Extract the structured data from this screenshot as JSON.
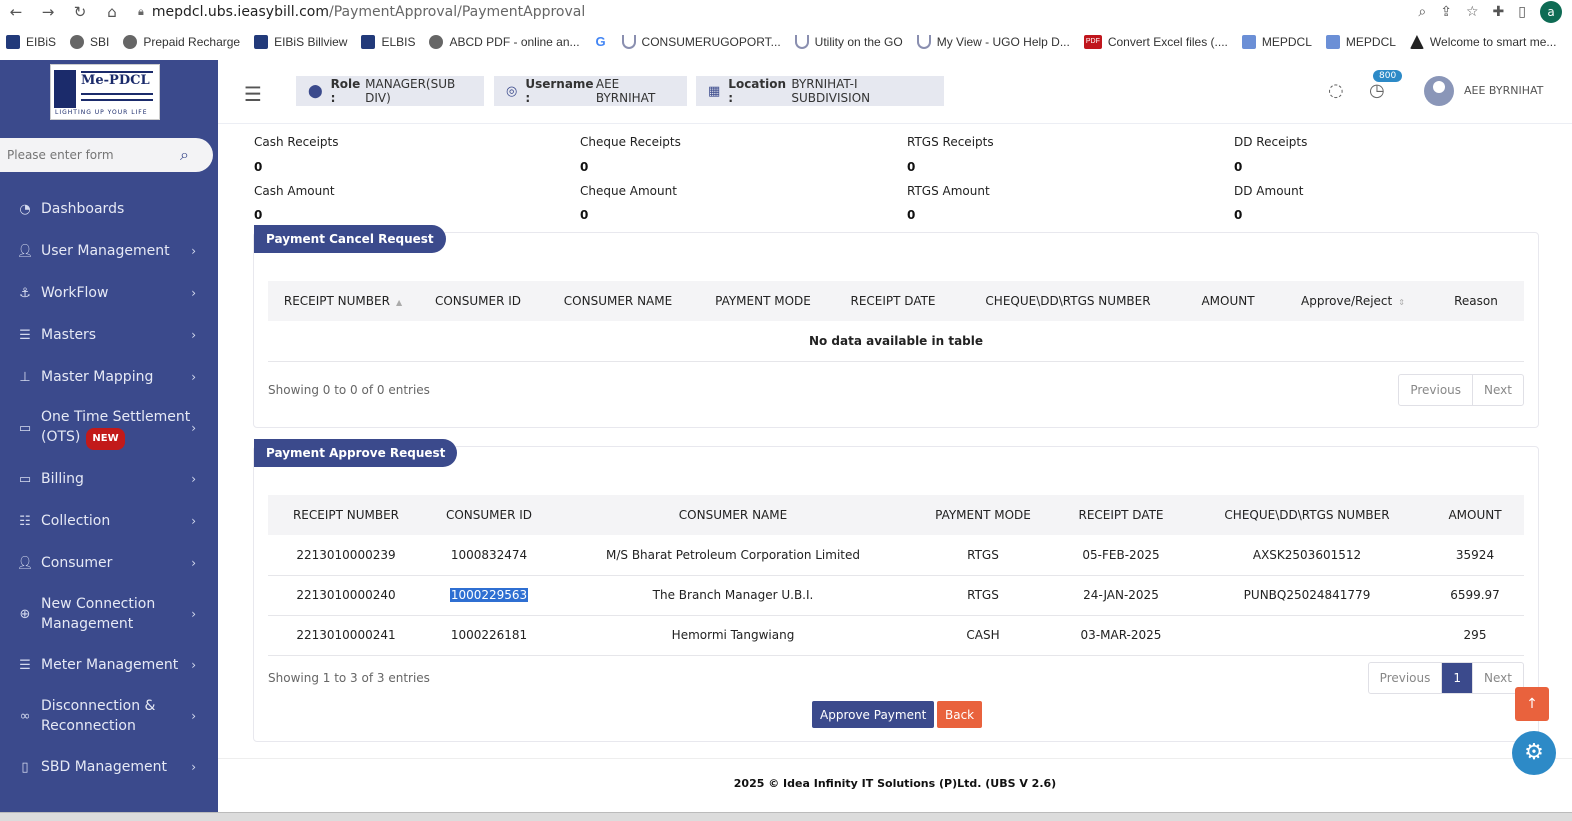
{
  "browser": {
    "url_domain": "mepdcl.ubs.ieasybill.com",
    "url_path": "/PaymentApproval/PaymentApproval",
    "profile_initial": "a",
    "bookmarks": [
      "EIBiS",
      "SBI",
      "Prepaid Recharge",
      "EIBiS Billview",
      "ELBIS",
      "ABCD PDF - online an...",
      "",
      "CONSUMERUGOPORT...",
      "Utility on the GO",
      "My View - UGO Help D...",
      "Convert Excel files (....",
      "MEPDCL",
      "MEPDCL",
      "Welcome to smart me..."
    ]
  },
  "sidebar": {
    "logo_text": "Me-PDCL",
    "logo_tagline": "LIGHTING UP YOUR LIFE",
    "search_placeholder": "Please enter form",
    "items": [
      {
        "label": "Dashboards",
        "icon": "dashboard-icon"
      },
      {
        "label": "User Management",
        "icon": "user-icon"
      },
      {
        "label": "WorkFlow",
        "icon": "anchor-icon"
      },
      {
        "label": "Masters",
        "icon": "list-icon"
      },
      {
        "label": "Master Mapping",
        "icon": "sitemap-icon"
      },
      {
        "label": "One Time Settlement (OTS)",
        "icon": "monitor-icon",
        "badge": "NEW"
      },
      {
        "label": "Billing",
        "icon": "monitor-icon"
      },
      {
        "label": "Collection",
        "icon": "list-icon"
      },
      {
        "label": "Consumer",
        "icon": "user-icon"
      },
      {
        "label": "New Connection Management",
        "icon": "plus-circle-icon"
      },
      {
        "label": "Meter Management",
        "icon": "list-icon"
      },
      {
        "label": "Disconnection & Reconnection",
        "icon": "link-icon"
      },
      {
        "label": "SBD Management",
        "icon": "mobile-icon"
      }
    ]
  },
  "topbar": {
    "role_key": "Role :",
    "role_val": "MANAGER(SUB DIV)",
    "username_key": "Username :",
    "username_val": "AEE BYRNIHAT",
    "location_key": "Location :",
    "location_val": "BYRNIHAT-I SUBDIVISION",
    "notification_count": "800",
    "user_name": "AEE BYRNIHAT"
  },
  "summary": {
    "cash_receipts_label": "Cash Receipts",
    "cash_receipts": "0",
    "cheque_receipts_label": "Cheque Receipts",
    "cheque_receipts": "0",
    "rtgs_receipts_label": "RTGS Receipts",
    "rtgs_receipts": "0",
    "dd_receipts_label": "DD Receipts",
    "dd_receipts": "0",
    "cash_amount_label": "Cash Amount",
    "cash_amount": "0",
    "cheque_amount_label": "Cheque Amount",
    "cheque_amount": "0",
    "rtgs_amount_label": "RTGS Amount",
    "rtgs_amount": "0",
    "dd_amount_label": "DD Amount",
    "dd_amount": "0"
  },
  "cancel_request": {
    "title": "Payment Cancel Request",
    "columns": [
      "RECEIPT NUMBER",
      "CONSUMER ID",
      "CONSUMER NAME",
      "PAYMENT MODE",
      "RECEIPT DATE",
      "CHEQUE\\DD\\RTGS NUMBER",
      "AMOUNT",
      "Approve/Reject",
      "Reason"
    ],
    "empty_text": "No data available in table",
    "showing": "Showing 0 to 0 of 0 entries",
    "prev": "Previous",
    "next": "Next"
  },
  "approve_request": {
    "title": "Payment Approve Request",
    "columns": [
      "RECEIPT NUMBER",
      "CONSUMER ID",
      "CONSUMER NAME",
      "PAYMENT MODE",
      "RECEIPT DATE",
      "CHEQUE\\DD\\RTGS NUMBER",
      "AMOUNT"
    ],
    "rows": [
      [
        "2213010000239",
        "1000832474",
        "M/S Bharat Petroleum Corporation Limited",
        "RTGS",
        "05-FEB-2025",
        "AXSK2503601512",
        "35924"
      ],
      [
        "2213010000240",
        "1000229563",
        "The Branch Manager U.B.I.",
        "RTGS",
        "24-JAN-2025",
        "PUNBQ25024841779",
        "6599.97"
      ],
      [
        "2213010000241",
        "1000226181",
        "Hemormi Tangwiang",
        "CASH",
        "03-MAR-2025",
        "",
        "295"
      ]
    ],
    "showing": "Showing 1 to 3 of 3 entries",
    "prev": "Previous",
    "page": "1",
    "next": "Next",
    "approve_btn": "Approve Payment",
    "back_btn": "Back"
  },
  "footer": "2025 © Idea Infinity IT Solutions (P)Ltd. (UBS V 2.6)"
}
